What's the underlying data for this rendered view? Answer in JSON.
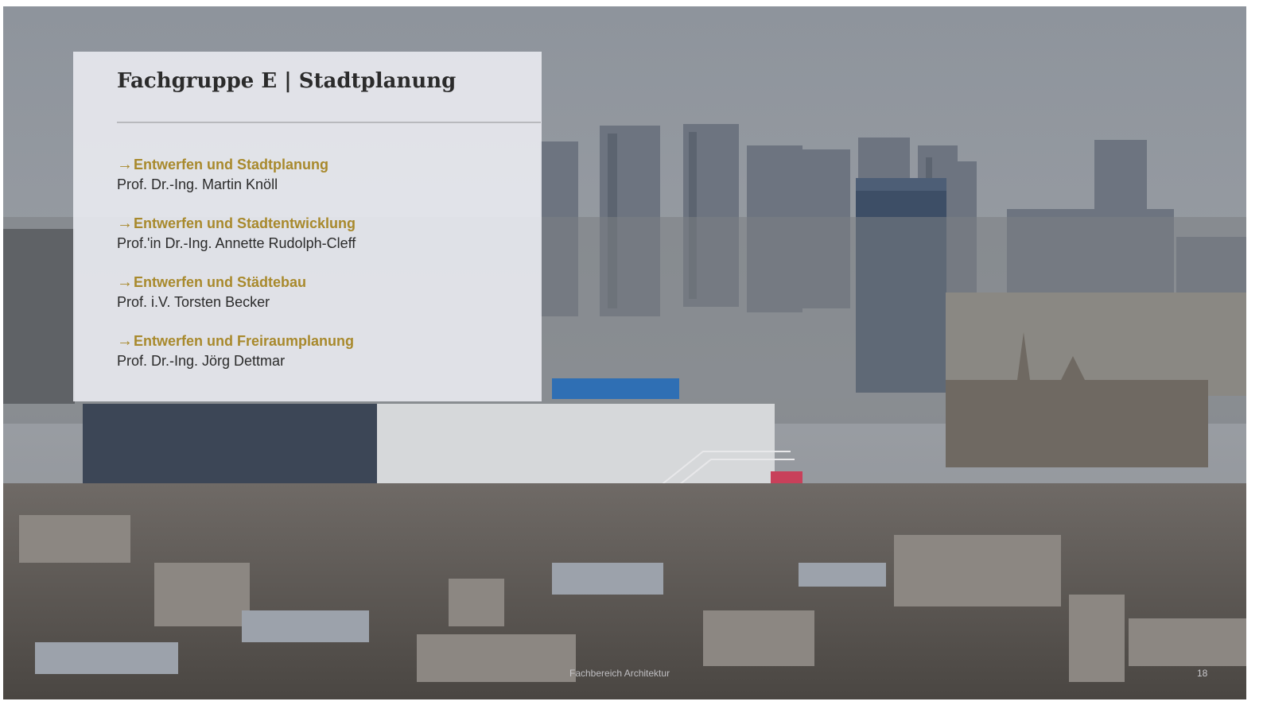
{
  "slide": {
    "title": "Fachgruppe E | Stadtplanung",
    "arrow_glyph": "→",
    "entries": [
      {
        "heading": "Entwerfen und Stadtplanung",
        "person": "Prof. Dr.-Ing. Martin Knöll"
      },
      {
        "heading": "Entwerfen und Stadtentwicklung",
        "person": "Prof.'in Dr.-Ing. Annette Rudolph-Cleff"
      },
      {
        "heading": "Entwerfen und Städtebau",
        "person": "Prof. i.V. Torsten Becker"
      },
      {
        "heading": "Entwerfen und Freiraumplanung",
        "person": "Prof. Dr.-Ing. Jörg Dettmar"
      }
    ],
    "footer": "Fachbereich Architektur",
    "page_number": "18"
  },
  "colors": {
    "accent": "#a8892c",
    "panel_background": "#ecedf2",
    "title_text": "#2b2b2b",
    "body_text": "#2a2a2a"
  },
  "background_image": "paris-skyline-photo"
}
